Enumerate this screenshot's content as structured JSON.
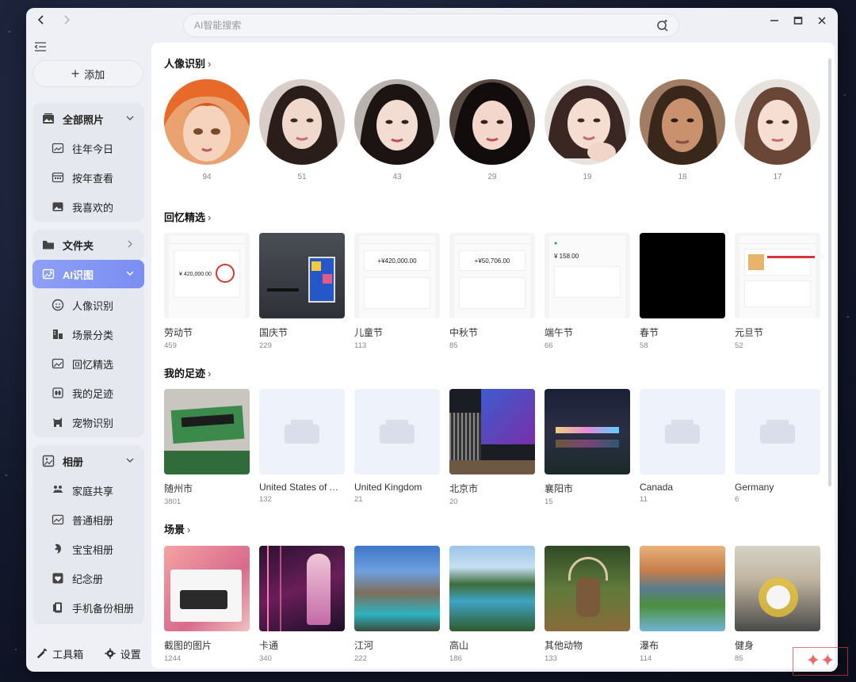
{
  "search": {
    "placeholder": "AI智能搜索"
  },
  "sidebar": {
    "add_label": "添加",
    "all_photos": {
      "label": "全部照片",
      "items": [
        {
          "label": "往年今日",
          "icon": "calendar-photo-icon"
        },
        {
          "label": "按年查看",
          "icon": "calendar-icon"
        },
        {
          "label": "我喜欢的",
          "icon": "heart-photo-icon"
        }
      ]
    },
    "folders_label": "文件夹",
    "ai": {
      "label": "AI识图",
      "items": [
        {
          "label": "人像识别",
          "icon": "face-icon"
        },
        {
          "label": "场景分类",
          "icon": "scene-icon"
        },
        {
          "label": "回忆精选",
          "icon": "memory-icon"
        },
        {
          "label": "我的足迹",
          "icon": "footprint-icon"
        },
        {
          "label": "宠物识别",
          "icon": "pet-icon"
        }
      ]
    },
    "albums": {
      "label": "相册",
      "items": [
        {
          "label": "家庭共享",
          "icon": "family-icon"
        },
        {
          "label": "普通相册",
          "icon": "album-icon"
        },
        {
          "label": "宝宝相册",
          "icon": "baby-icon"
        },
        {
          "label": "纪念册",
          "icon": "heart-icon"
        },
        {
          "label": "手机备份相册",
          "icon": "phone-icon"
        }
      ]
    },
    "toolbox_label": "工具箱",
    "settings_label": "设置"
  },
  "sections": {
    "people": {
      "title": "人像识别",
      "counts": [
        "94",
        "51",
        "43",
        "29",
        "19",
        "18",
        "17"
      ]
    },
    "memories": {
      "title": "回忆精选",
      "items": [
        {
          "name": "劳动节",
          "count": "459",
          "screen_amount": "¥ 420,000.00"
        },
        {
          "name": "国庆节",
          "count": "229"
        },
        {
          "name": "儿童节",
          "count": "113",
          "screen_amount": "+¥420,000.00"
        },
        {
          "name": "中秋节",
          "count": "85",
          "screen_amount": "+¥50,706.00"
        },
        {
          "name": "端午节",
          "count": "66",
          "screen_amount": "¥ 158.00"
        },
        {
          "name": "春节",
          "count": "58"
        },
        {
          "name": "元旦节",
          "count": "52"
        }
      ]
    },
    "footprints": {
      "title": "我的足迹",
      "items": [
        {
          "name": "随州市",
          "count": "3801"
        },
        {
          "name": "United States of America",
          "count": "132"
        },
        {
          "name": "United Kingdom",
          "count": "21"
        },
        {
          "name": "北京市",
          "count": "20"
        },
        {
          "name": "襄阳市",
          "count": "15"
        },
        {
          "name": "Canada",
          "count": "11"
        },
        {
          "name": "Germany",
          "count": "6"
        }
      ]
    },
    "scenes": {
      "title": "场景",
      "items": [
        {
          "name": "截图的图片",
          "count": "1244"
        },
        {
          "name": "卡通",
          "count": "340"
        },
        {
          "name": "江河",
          "count": "222"
        },
        {
          "name": "高山",
          "count": "186"
        },
        {
          "name": "其他动物",
          "count": "133"
        },
        {
          "name": "瀑布",
          "count": "114"
        },
        {
          "name": "健身",
          "count": "85"
        }
      ]
    }
  },
  "accent_color": "#7f92f3"
}
